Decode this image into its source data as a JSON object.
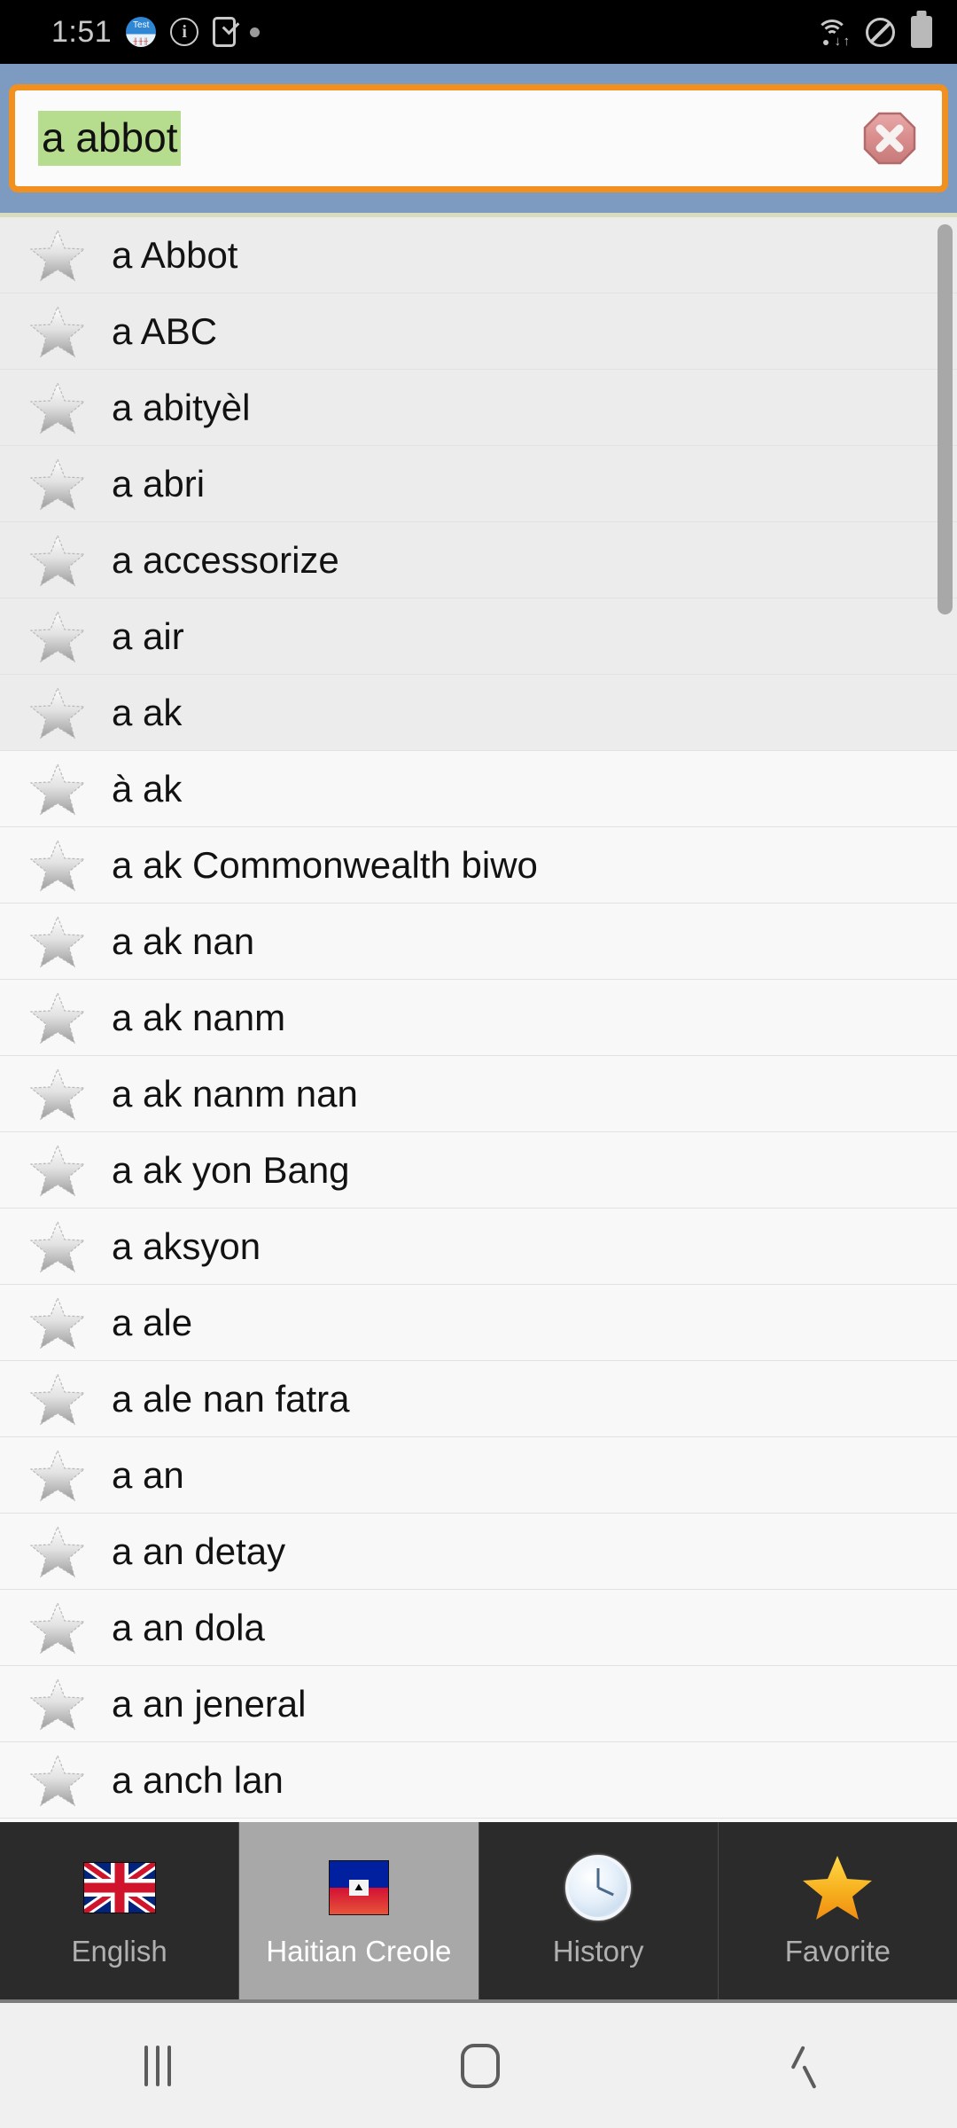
{
  "status_bar": {
    "time": "1:51",
    "app_icon_label": "Test",
    "icons_left": [
      "test-app-icon",
      "info-circle-icon",
      "device-check-icon",
      "dot-icon"
    ],
    "icons_right": [
      "wifi-transfer-icon",
      "do-not-disturb-icon",
      "battery-icon"
    ]
  },
  "search": {
    "value": "a abbot",
    "placeholder": "",
    "clear_icon": "clear-octagon-icon",
    "selection_color": "#b6dd8e",
    "border_color": "#f2901f",
    "header_color": "#7d9bc1"
  },
  "list": {
    "favorite_icon": "star-outline-icon",
    "items": [
      {
        "label": "a Abbot"
      },
      {
        "label": "a ABC"
      },
      {
        "label": "a abityèl"
      },
      {
        "label": "a abri"
      },
      {
        "label": "a accessorize"
      },
      {
        "label": "a air"
      },
      {
        "label": "a ak"
      },
      {
        "label": "à ak"
      },
      {
        "label": "a ak Commonwealth biwo"
      },
      {
        "label": "a ak nan"
      },
      {
        "label": "a ak nanm"
      },
      {
        "label": "a ak nanm nan"
      },
      {
        "label": "a ak yon Bang"
      },
      {
        "label": "a aksyon"
      },
      {
        "label": "a ale"
      },
      {
        "label": "a ale nan fatra"
      },
      {
        "label": "a an"
      },
      {
        "label": "a an detay"
      },
      {
        "label": "a an dola"
      },
      {
        "label": "a an jeneral"
      },
      {
        "label": "a anch lan"
      }
    ]
  },
  "tabs": [
    {
      "label": "English",
      "icon": "uk-flag-icon",
      "active": false
    },
    {
      "label": "Haitian Creole",
      "icon": "haiti-flag-icon",
      "active": true
    },
    {
      "label": "History",
      "icon": "clock-icon",
      "active": false
    },
    {
      "label": "Favorite",
      "icon": "gold-star-icon",
      "active": false
    }
  ],
  "nav_bar": {
    "recents_label": "recents-button",
    "home_label": "home-button",
    "back_label": "back-button"
  }
}
